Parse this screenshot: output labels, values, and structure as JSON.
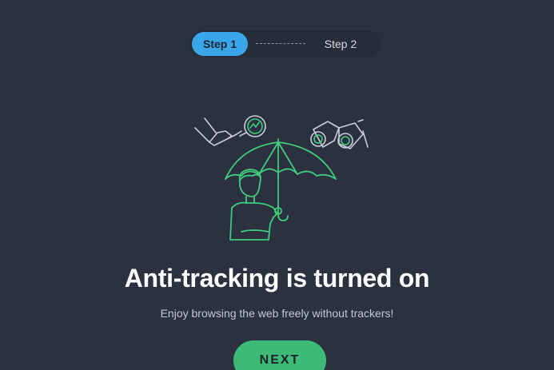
{
  "stepper": {
    "step1_label": "Step 1",
    "step2_label": "Step 2",
    "active_step": 1
  },
  "illustration": {
    "icons": [
      "magnifier-icon",
      "binoculars-icon",
      "person-with-umbrella-illustration"
    ]
  },
  "content": {
    "title": "Anti-tracking is turned on",
    "subtitle": "Enjoy browsing the web freely without trackers!"
  },
  "actions": {
    "next_label": "NEXT"
  },
  "colors": {
    "background": "#2b313e",
    "accent_blue": "#3aa6ea",
    "accent_green": "#3dbb76",
    "illustration_green": "#3fcc7c",
    "illustration_gray": "#c9ced6"
  }
}
